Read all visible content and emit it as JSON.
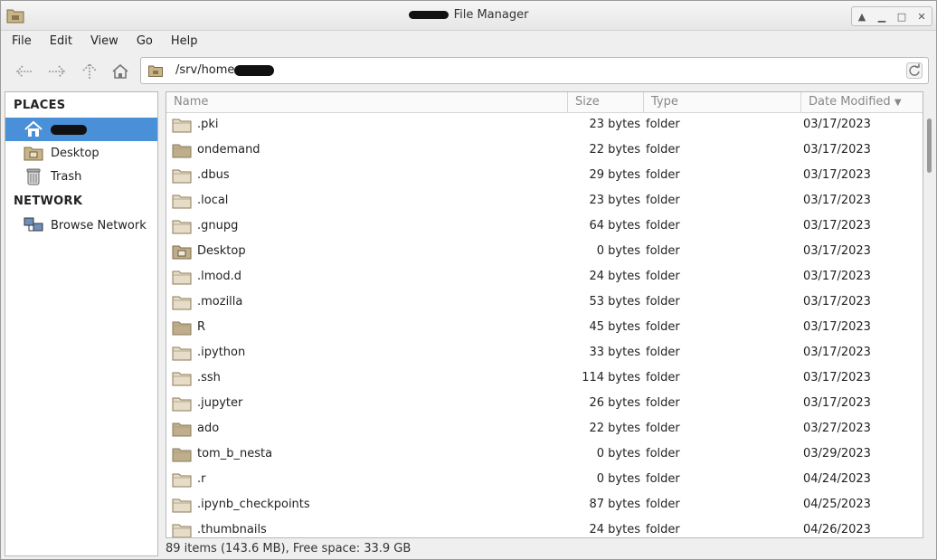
{
  "window": {
    "title": "File Manager",
    "buttons": [
      "up-icon",
      "minimize-icon",
      "maximize-icon",
      "close-icon"
    ]
  },
  "menubar": {
    "items": [
      "File",
      "Edit",
      "View",
      "Go",
      "Help"
    ]
  },
  "toolbar": {
    "location": "/srv/home"
  },
  "sidebar": {
    "places_label": "PLACES",
    "network_label": "NETWORK",
    "places": [
      {
        "label": "",
        "icon": "home-icon",
        "redacted": true
      },
      {
        "label": "Desktop",
        "icon": "desktop-folder-icon"
      },
      {
        "label": "Trash",
        "icon": "trash-icon"
      }
    ],
    "network": [
      {
        "label": "Browse Network",
        "icon": "network-icon"
      }
    ]
  },
  "columns": {
    "name": "Name",
    "size": "Size",
    "type": "Type",
    "date": "Date Modified"
  },
  "files": [
    {
      "name": ".pki",
      "size": "23 bytes",
      "type": "folder",
      "date": "03/17/2023",
      "icon": "folder-light"
    },
    {
      "name": "ondemand",
      "size": "22 bytes",
      "type": "folder",
      "date": "03/17/2023",
      "icon": "folder-dark"
    },
    {
      "name": ".dbus",
      "size": "29 bytes",
      "type": "folder",
      "date": "03/17/2023",
      "icon": "folder-light"
    },
    {
      "name": ".local",
      "size": "23 bytes",
      "type": "folder",
      "date": "03/17/2023",
      "icon": "folder-light"
    },
    {
      "name": ".gnupg",
      "size": "64 bytes",
      "type": "folder",
      "date": "03/17/2023",
      "icon": "folder-light"
    },
    {
      "name": "Desktop",
      "size": "0 bytes",
      "type": "folder",
      "date": "03/17/2023",
      "icon": "folder-desktop"
    },
    {
      "name": ".lmod.d",
      "size": "24 bytes",
      "type": "folder",
      "date": "03/17/2023",
      "icon": "folder-light"
    },
    {
      "name": ".mozilla",
      "size": "53 bytes",
      "type": "folder",
      "date": "03/17/2023",
      "icon": "folder-light"
    },
    {
      "name": "R",
      "size": "45 bytes",
      "type": "folder",
      "date": "03/17/2023",
      "icon": "folder-dark"
    },
    {
      "name": ".ipython",
      "size": "33 bytes",
      "type": "folder",
      "date": "03/17/2023",
      "icon": "folder-light"
    },
    {
      "name": ".ssh",
      "size": "114 bytes",
      "type": "folder",
      "date": "03/17/2023",
      "icon": "folder-light"
    },
    {
      "name": ".jupyter",
      "size": "26 bytes",
      "type": "folder",
      "date": "03/17/2023",
      "icon": "folder-light"
    },
    {
      "name": "ado",
      "size": "22 bytes",
      "type": "folder",
      "date": "03/27/2023",
      "icon": "folder-dark"
    },
    {
      "name": "tom_b_nesta",
      "size": "0 bytes",
      "type": "folder",
      "date": "03/29/2023",
      "icon": "folder-dark"
    },
    {
      "name": ".r",
      "size": "0 bytes",
      "type": "folder",
      "date": "04/24/2023",
      "icon": "folder-light"
    },
    {
      "name": ".ipynb_checkpoints",
      "size": "87 bytes",
      "type": "folder",
      "date": "04/25/2023",
      "icon": "folder-light"
    },
    {
      "name": ".thumbnails",
      "size": "24 bytes",
      "type": "folder",
      "date": "04/26/2023",
      "icon": "folder-light"
    }
  ],
  "status": {
    "text": "89 items (143.6 MB), Free space: 33.9 GB"
  },
  "colors": {
    "selection": "#4a90d9",
    "folder_light": "#e6dcc8",
    "folder_dark": "#bfae8c"
  }
}
